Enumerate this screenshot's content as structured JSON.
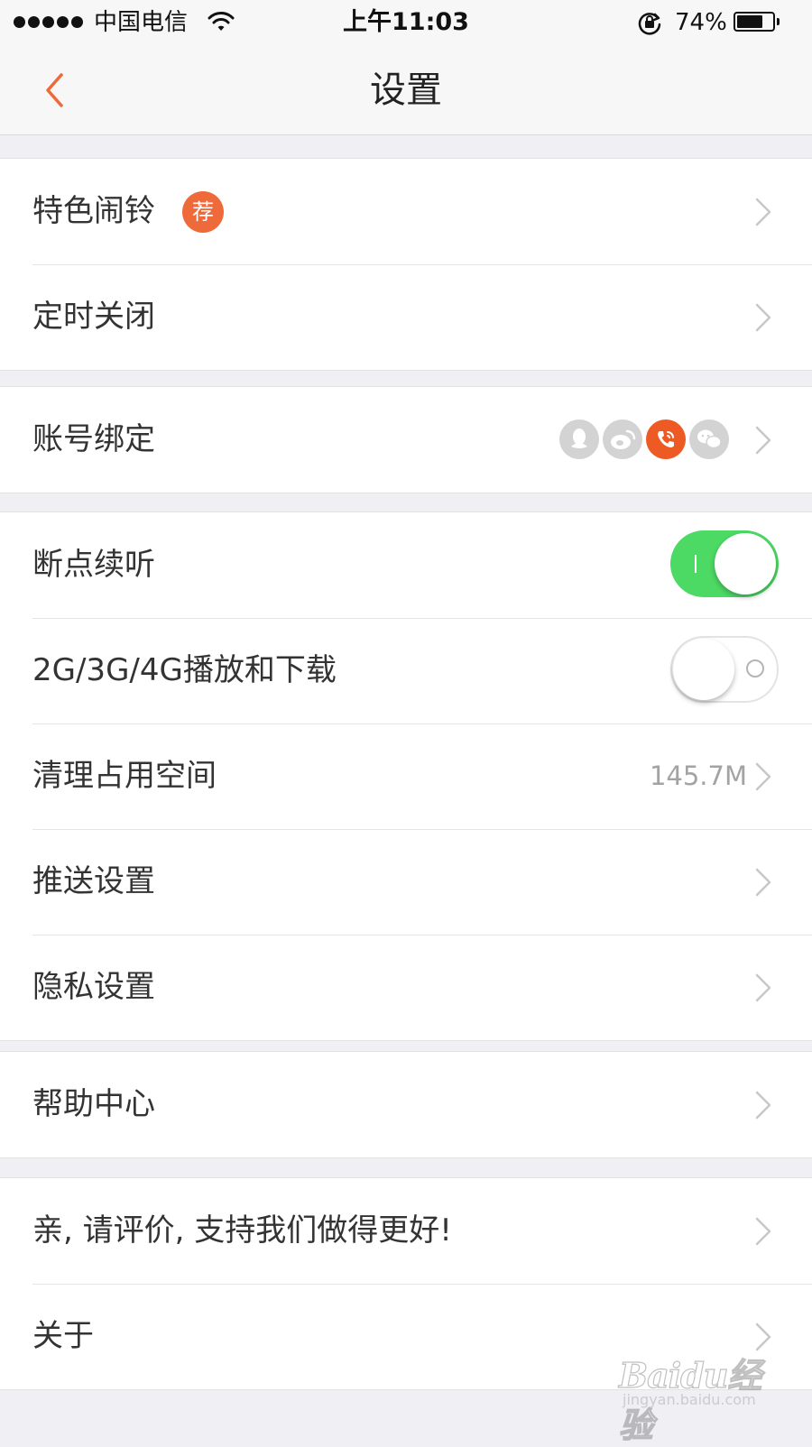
{
  "status_bar": {
    "carrier": "中国电信",
    "time": "上午11:03",
    "battery_percent": "74%",
    "battery_level": 0.74,
    "icons": [
      "signal-dots-icon",
      "wifi-icon",
      "rotation-lock-icon",
      "battery-icon"
    ]
  },
  "nav": {
    "title": "设置",
    "back_icon": "chevron-left-icon"
  },
  "colors": {
    "accent": "#ee5a24",
    "switch_on": "#4cd964",
    "background": "#efeff4"
  },
  "groups": [
    {
      "rows": [
        {
          "label": "特色闹铃",
          "badge": "荐"
        },
        {
          "label": "定时关闭"
        }
      ]
    },
    {
      "rows": [
        {
          "label": "账号绑定",
          "accounts": [
            "qq-icon",
            "weibo-icon",
            "phone-icon",
            "wechat-icon"
          ],
          "active_account": "phone-icon"
        }
      ]
    },
    {
      "rows": [
        {
          "label": "断点续听",
          "switch": "on"
        },
        {
          "label": "2G/3G/4G播放和下载",
          "switch": "off"
        },
        {
          "label": "清理占用空间",
          "value": "145.7M"
        },
        {
          "label": "推送设置"
        },
        {
          "label": "隐私设置"
        }
      ]
    },
    {
      "rows": [
        {
          "label": "帮助中心"
        }
      ]
    },
    {
      "rows": [
        {
          "label": "亲, 请评价, 支持我们做得更好!"
        },
        {
          "label": "关于"
        }
      ]
    }
  ],
  "watermark": {
    "brand": "Baidu经验",
    "url": "jingyan.baidu.com"
  }
}
